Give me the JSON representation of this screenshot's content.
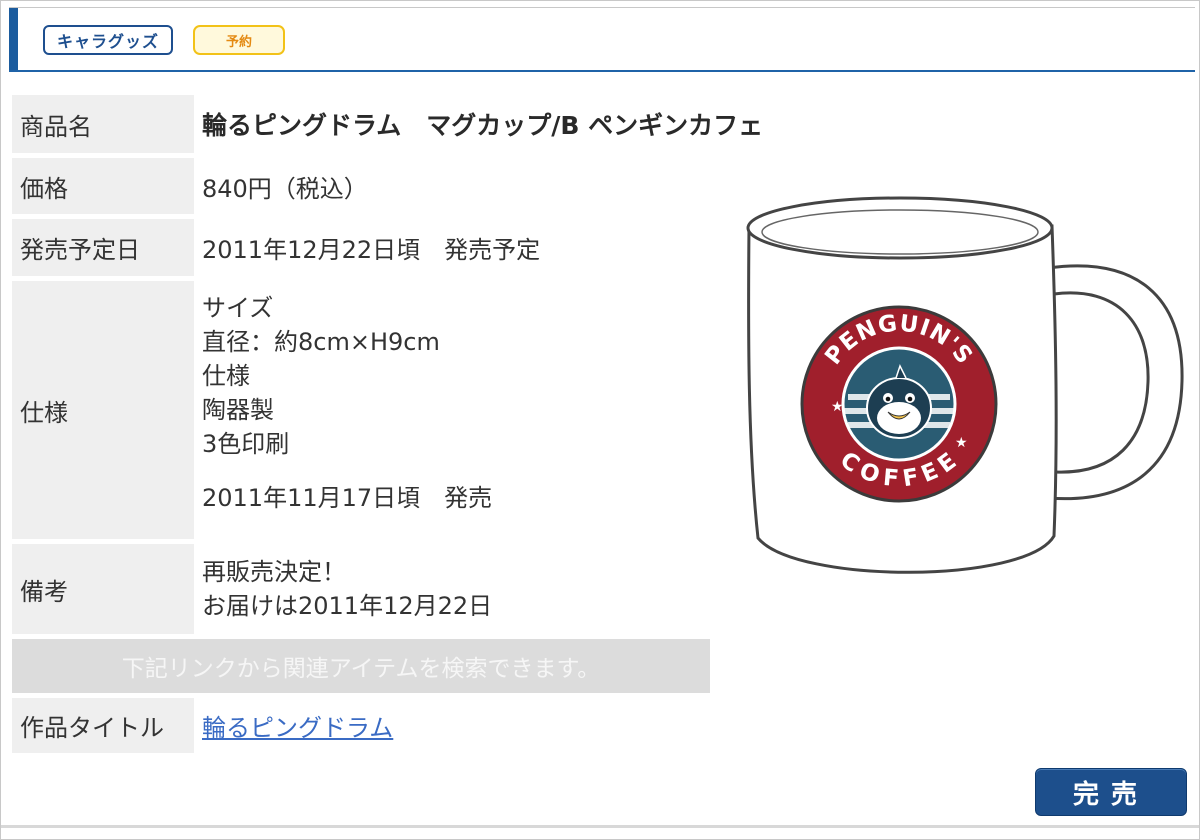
{
  "badges": {
    "category": "キャラグッズ",
    "status": "予約"
  },
  "product": {
    "name_label": "商品名",
    "name": "輪るピングドラム　マグカップ/B ペンギンカフェ",
    "price_label": "価格",
    "price": "840円（税込）",
    "release_label": "発売予定日",
    "release": "2011年12月22日頃　発売予定",
    "spec_label": "仕様",
    "spec_lines": [
      "サイズ",
      "直径：約8cm×H9cm",
      "仕様",
      "陶器製",
      "3色印刷",
      "",
      "2011年11月17日頃　発売"
    ],
    "note_label": "備考",
    "note_lines": [
      "再販売決定！",
      "お届けは2011年12月22日"
    ],
    "search_notice": "下記リンクから関連アイテムを検索できます。",
    "title_label": "作品タイトル",
    "title_link": "輪るピングドラム"
  },
  "image": {
    "logo_top_text": "PENGUIN'S",
    "logo_bottom_text": "COFFEE"
  },
  "button": {
    "sold_out": "完売"
  },
  "colors": {
    "brand_blue": "#1b5c9e",
    "label_bg": "#efefef",
    "badge_yellow": "#f2c218",
    "logo_red": "#a01f2c",
    "link": "#3a6bc4"
  }
}
